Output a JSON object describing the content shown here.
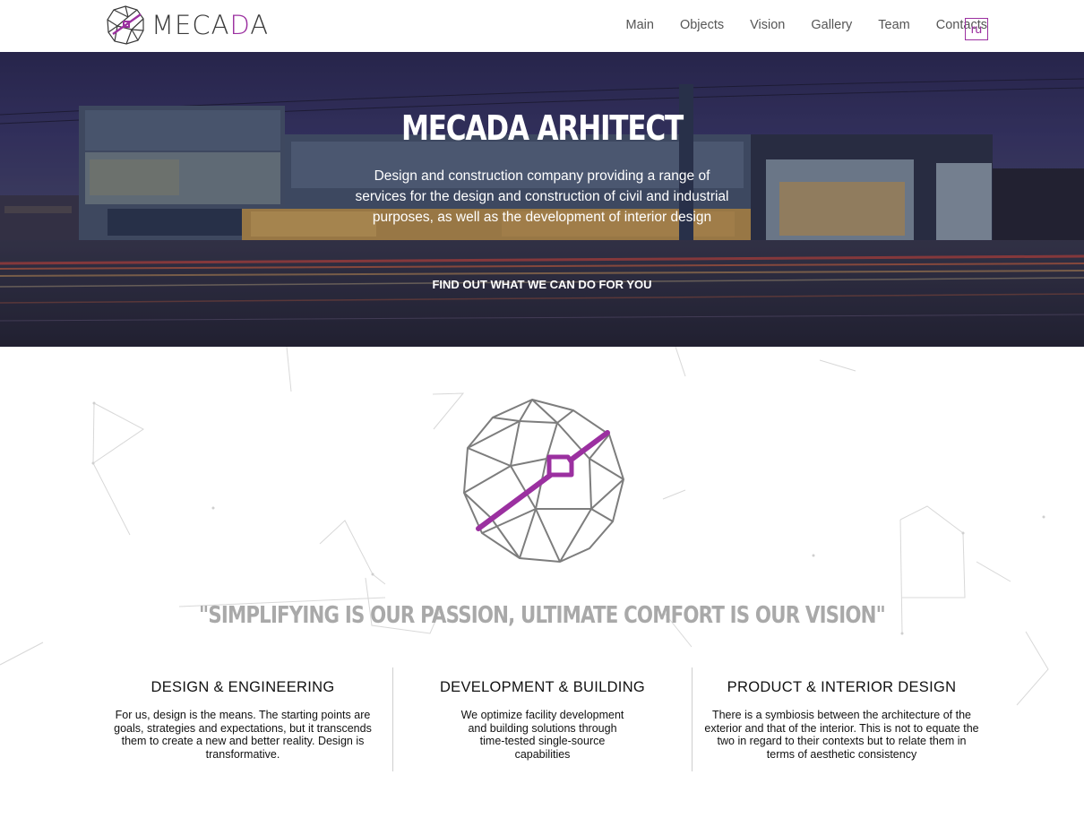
{
  "brand": {
    "logo_text_part1": "MECA",
    "logo_text_accent": "D",
    "logo_text_part2": "A",
    "accent_color": "#9b30a0"
  },
  "nav": {
    "items": [
      "Main",
      "Objects",
      "Vision",
      "Gallery",
      "Team",
      "Contacts"
    ],
    "language": "ru"
  },
  "hero": {
    "title": "MECADA ARHITECT",
    "description": "Design and construction company providing a range of services for the design and construction of civil and industrial purposes, as well as the development of interior design",
    "cta": "FIND OUT WHAT WE CAN DO FOR YOU"
  },
  "slogan": "\"SIMPLIFYING IS OUR PASSION, ULTIMATE COMFORT IS OUR VISION\"",
  "services": [
    {
      "title": "DESIGN & ENGINEERING",
      "text": "For us, design is the means. The starting points are goals, strategies and expectations, but it transcends them to create a new and better reality. Design is transformative."
    },
    {
      "title": "DEVELOPMENT & BUILDING",
      "text": "We optimize facility development and building solutions through time-tested single-source capabilities"
    },
    {
      "title": "PRODUCT & INTERIOR DESIGN",
      "text": "There is a symbiosis between the architecture of the exterior and that of the interior. This is not to equate the two in regard to their contexts but to relate them in terms of aesthetic consistency"
    }
  ]
}
